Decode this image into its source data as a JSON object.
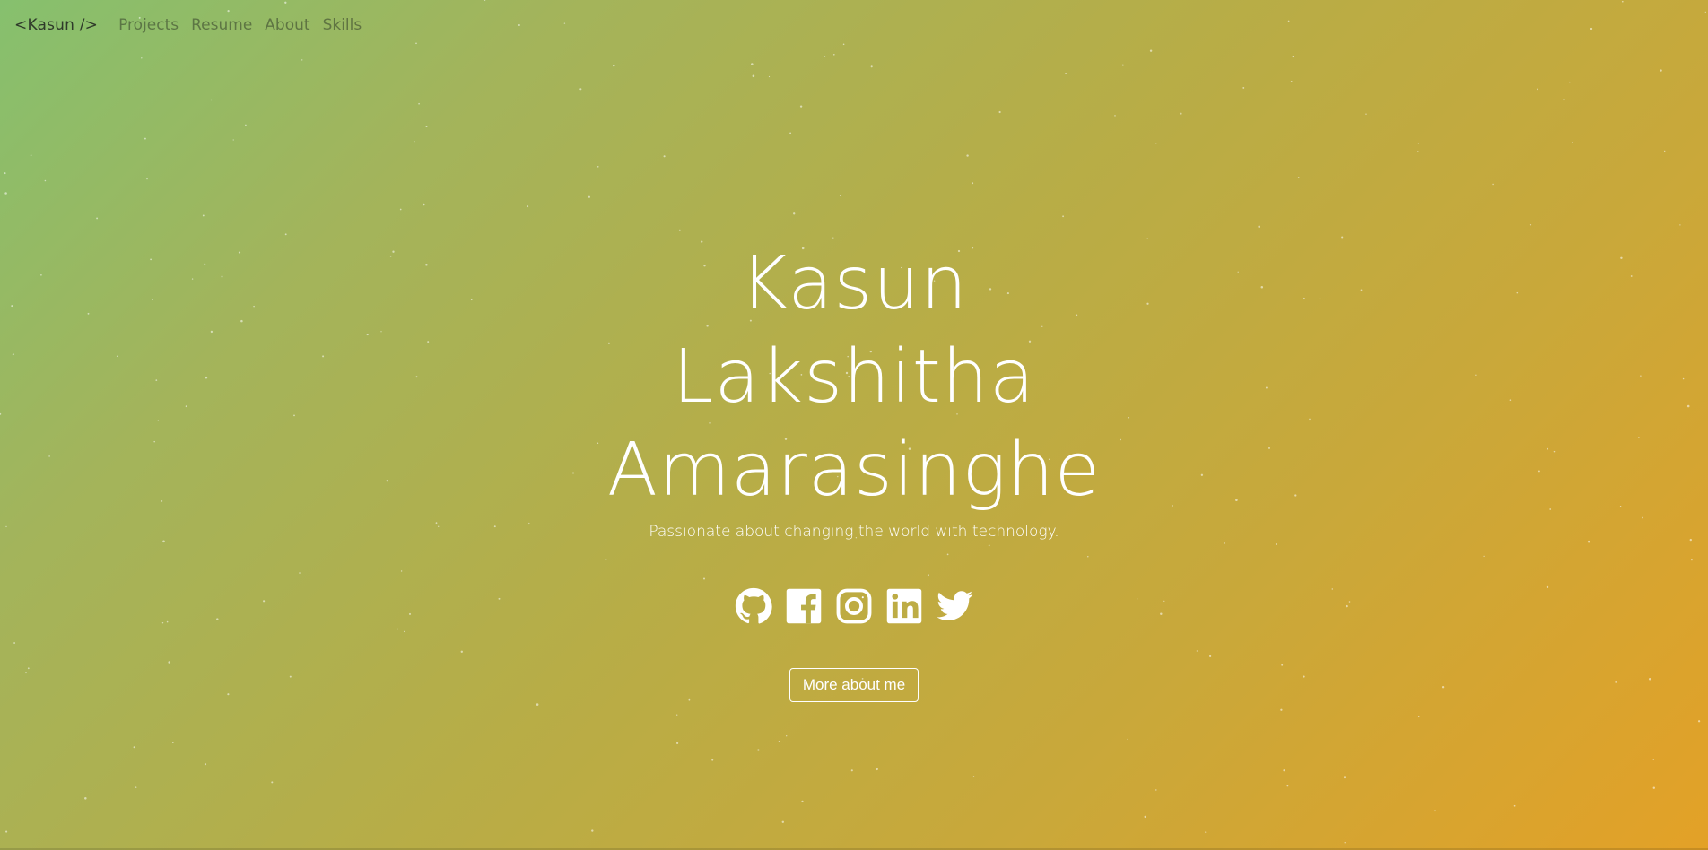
{
  "nav": {
    "brand": "<Kasun />",
    "links": [
      "Projects",
      "Resume",
      "About",
      "Skills"
    ]
  },
  "hero": {
    "name": "Kasun Lakshitha Amarasinghe",
    "tagline": "Passionate about changing the world with technology.",
    "cta": "More about me"
  },
  "social": [
    {
      "icon": "github-icon"
    },
    {
      "icon": "facebook-icon"
    },
    {
      "icon": "instagram-icon"
    },
    {
      "icon": "linkedin-icon"
    },
    {
      "icon": "twitter-icon"
    }
  ],
  "colors": {
    "gradient_start": "#86c06e",
    "gradient_end": "#e3a127",
    "text": "#ffffff"
  }
}
